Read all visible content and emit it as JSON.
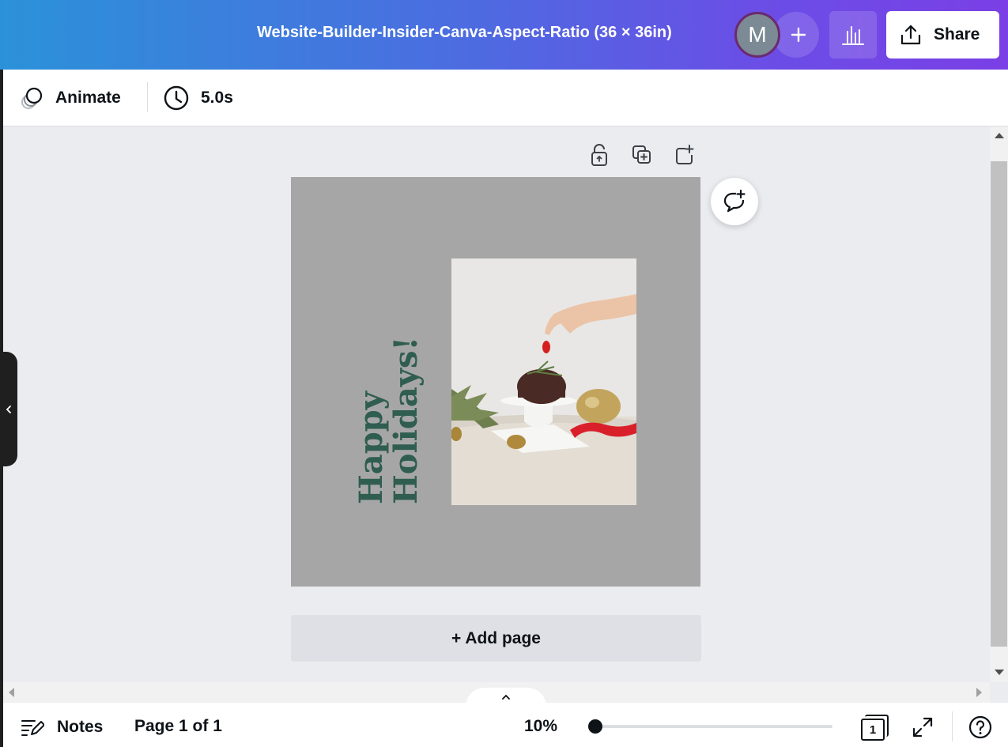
{
  "header": {
    "doc_title": "Website-Builder-Insider-Canva-Aspect-Ratio (36 × 36in)",
    "avatar_initial": "M",
    "share_label": "Share"
  },
  "toolbar": {
    "animate_label": "Animate",
    "duration_label": "5.0s"
  },
  "canvas": {
    "headline_line1": "Happy",
    "headline_line2": "Holidays!",
    "headline_color": "#2f5d50",
    "page_background": "#a6a6a6",
    "add_page_label": "+ Add page"
  },
  "footer": {
    "notes_label": "Notes",
    "page_count": "Page 1 of 1",
    "zoom_label": "10%",
    "zoom_percent": 10,
    "page_grid_number": "1"
  },
  "colors": {
    "gradient_start": "#2b92d9",
    "gradient_end": "#7a3fe6",
    "text_primary": "#0e1318"
  },
  "icons": [
    "animate-icon",
    "clock-icon",
    "unlock-icon",
    "duplicate-page-icon",
    "add-page-icon",
    "add-comment-icon",
    "plus-icon",
    "insights-icon",
    "share-icon",
    "notes-icon",
    "fullscreen-icon",
    "help-icon",
    "chevron-left-icon",
    "chevron-up-icon"
  ]
}
